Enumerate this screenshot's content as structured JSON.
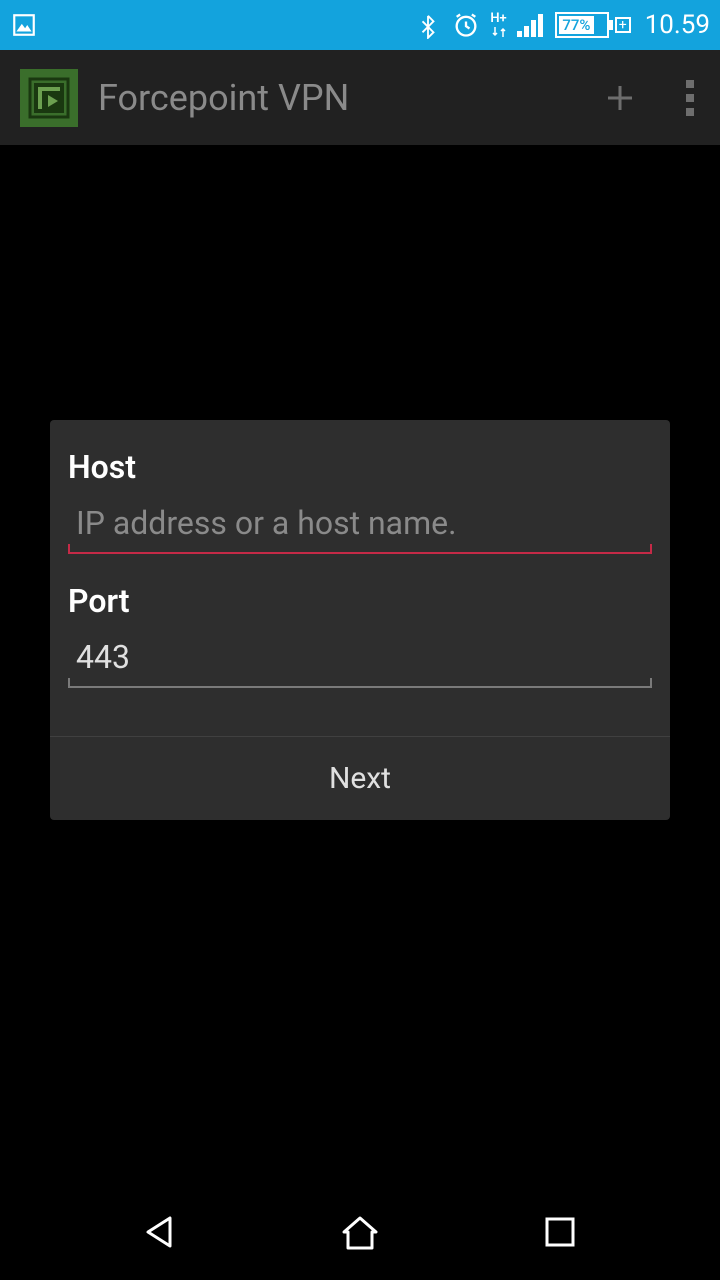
{
  "status": {
    "battery_pct": "77%",
    "clock": "10.59",
    "network_label": "H+"
  },
  "appbar": {
    "title": "Forcepoint VPN"
  },
  "dialog": {
    "host_label": "Host",
    "host_placeholder": "IP address or a host name.",
    "host_value": "",
    "port_label": "Port",
    "port_value": "443",
    "next_label": "Next"
  }
}
